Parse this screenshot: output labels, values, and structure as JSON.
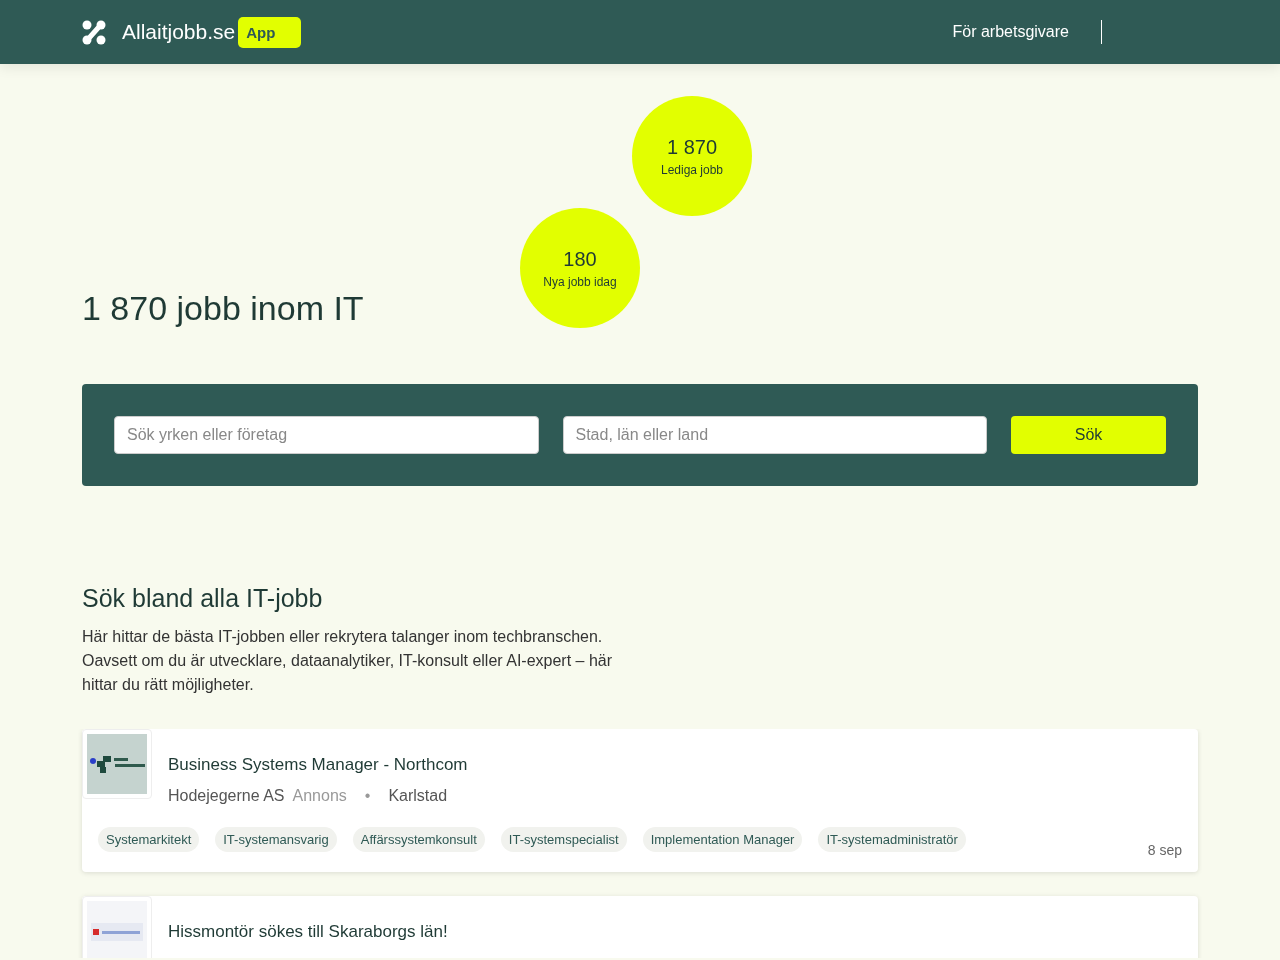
{
  "header": {
    "brand": "Allaitjobb.se",
    "badge": "App",
    "nav": [
      "För arbetsgivare"
    ]
  },
  "stats": [
    {
      "value": "1 870",
      "label": "Lediga jobb"
    },
    {
      "value": "180",
      "label": "Nya jobb idag"
    }
  ],
  "heading": "1 870 jobb inom IT",
  "search": {
    "query": {
      "placeholder": "Sök yrken eller företag"
    },
    "location": {
      "placeholder": "Stad, län eller land"
    },
    "button": "Sök"
  },
  "intro": {
    "title": "Sök bland alla IT-jobb",
    "text": "Här hittar de bästa IT-jobben eller rekrytera talanger inom techbranschen. Oavsett om du är utvecklare, dataanalytiker, IT-konsult eller AI-expert – här hittar du rätt möjligheter."
  },
  "jobs": [
    {
      "title": "Business Systems Manager - Northcom",
      "company": "Hodejegerne AS",
      "ad_label": "Annons",
      "separator": "•",
      "location": "Karlstad",
      "tags": [
        "Systemarkitekt",
        "IT-systemansvarig",
        "Affärssystemkonsult",
        "IT-systemspecialist",
        "Implementation Manager",
        "IT-systemadministratör"
      ],
      "date": "8 sep"
    },
    {
      "title": "Hissmontör sökes till Skaraborgs län!"
    }
  ]
}
